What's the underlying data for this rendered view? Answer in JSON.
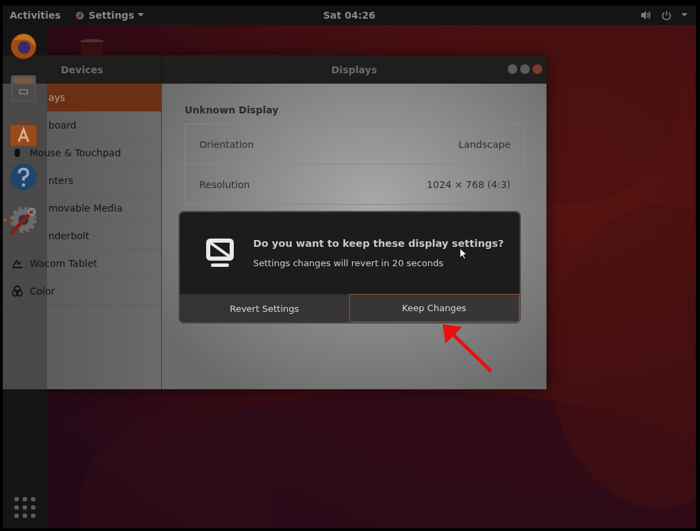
{
  "top_bar": {
    "activities": "Activities",
    "app_menu": "Settings",
    "clock": "Sat 04:26"
  },
  "dock": {
    "apps": [
      {
        "kind": "browser",
        "running": false
      },
      {
        "kind": "files",
        "running": false
      },
      {
        "kind": "software",
        "running": false
      },
      {
        "kind": "help",
        "running": false
      },
      {
        "kind": "settings",
        "running": true
      }
    ]
  },
  "window": {
    "title": "Displays",
    "sidebar_title": "Devices",
    "sidebar": {
      "items": [
        {
          "label": "ays",
          "selected": true,
          "covered": true
        },
        {
          "label": "board",
          "selected": false,
          "covered": true
        },
        {
          "label": "Mouse & Touchpad",
          "kind": "mouse",
          "selected": false,
          "covered": false
        },
        {
          "label": "nters",
          "selected": false,
          "covered": true
        },
        {
          "label": "movable Media",
          "selected": false,
          "covered": true
        },
        {
          "label": "nderbolt",
          "selected": false,
          "covered": true
        },
        {
          "label": "Wacom Tablet",
          "kind": "tablet",
          "selected": false,
          "covered": false
        },
        {
          "label": "Color",
          "kind": "color",
          "selected": false,
          "covered": false
        }
      ]
    },
    "content": {
      "section_title": "Unknown Display",
      "rows": [
        {
          "label": "Orientation",
          "value": "Landscape"
        },
        {
          "label": "Resolution",
          "value": "1024 × 768 (4:3)"
        }
      ]
    }
  },
  "dialog": {
    "title": "Do you want to keep these display settings?",
    "message": "Settings changes will revert in 20 seconds",
    "buttons": [
      {
        "label": "Revert Settings",
        "focused": false
      },
      {
        "label": "Keep Changes",
        "focused": true
      }
    ]
  }
}
